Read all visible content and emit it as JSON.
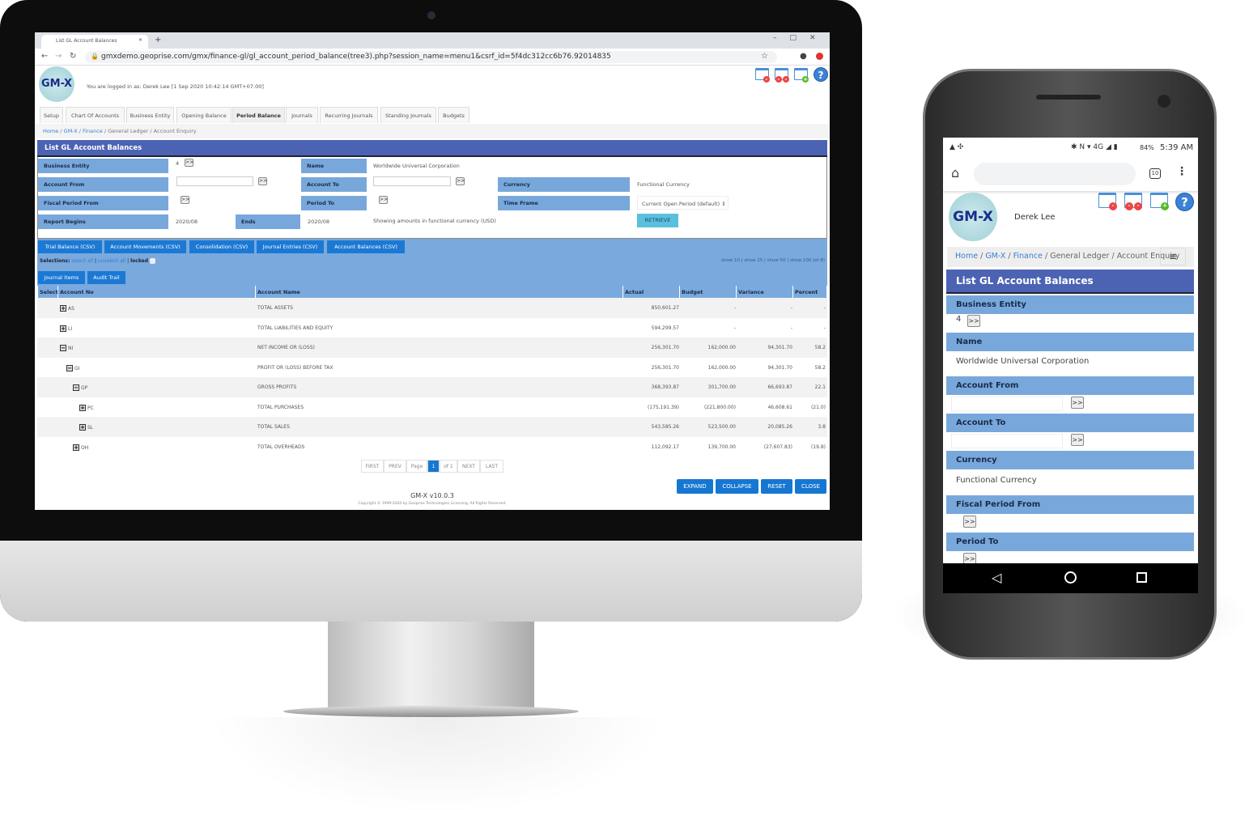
{
  "browser": {
    "tab_title": "List GL Account Balances",
    "url": "gmxdemo.geoprise.com/gmx/finance-gl/gl_account_period_balance(tree3).php?session_name=menu1&csrf_id=5f4dc312cc6b76.92014835"
  },
  "header": {
    "logo": "GM-X",
    "logged_in": "You are logged in as: Derek Lee [1 Sep 2020 10:42:14 GMT+07:00]",
    "icons": [
      "close-window-icon",
      "close-all-windows-icon",
      "new-window-icon",
      "help-icon"
    ],
    "help": "?"
  },
  "nav_tabs": [
    {
      "label": "Setup"
    },
    {
      "label": "Chart Of Accounts"
    },
    {
      "label": "Business Entity"
    },
    {
      "label": "Opening Balance"
    },
    {
      "label": "Period Balance",
      "active": true
    },
    {
      "label": "Journals"
    },
    {
      "label": "Recurring Journals"
    },
    {
      "label": "Standing Journals"
    },
    {
      "label": "Budgets"
    }
  ],
  "breadcrumb": {
    "items": [
      "Home",
      "GM-X",
      "Finance",
      "General Ledger",
      "Account Enquiry"
    ],
    "sep": "/"
  },
  "page_title": "List GL Account Balances",
  "form": {
    "business_entity": {
      "label": "Business Entity",
      "value": "4"
    },
    "name": {
      "label": "Name",
      "value": "Worldwide Universal Corporation"
    },
    "account_from": {
      "label": "Account From",
      "value": ""
    },
    "account_to": {
      "label": "Account To",
      "value": ""
    },
    "currency": {
      "label": "Currency",
      "value": "Functional Currency"
    },
    "fiscal_period_from": {
      "label": "Fiscal Period From"
    },
    "period_to": {
      "label": "Period To"
    },
    "time_frame": {
      "label": "Time Frame",
      "value": "Current Open Period (default) ⇕"
    },
    "report_begins": {
      "label": "Report Begins",
      "value": "2020/08"
    },
    "ends": {
      "label": "Ends",
      "value": "2020/08"
    },
    "note": "Showing amounts in functional currency (USD)",
    "lookup": ">>",
    "retrieve": "RETRIEVE"
  },
  "csv_buttons": [
    "Trial Balance (CSV)",
    "Account Movements (CSV)",
    "Consolidation (CSV)",
    "Journal Entries (CSV)",
    "Account Balances (CSV)"
  ],
  "selections": {
    "label": "Selections:",
    "select_all": "select all",
    "unselect_all": "unselect all",
    "locked": "locked",
    "show": "show 10 | show 25 | show 50 | show 100 (of 8)"
  },
  "sub_buttons": [
    "Journal Items",
    "Audit Trail"
  ],
  "table": {
    "columns": [
      "Select",
      "Account No",
      "Account Name",
      "Actual",
      "Budget",
      "Variance",
      "Percent"
    ],
    "rows": [
      {
        "level": 0,
        "toggle": "+",
        "no": "AS",
        "name": "TOTAL ASSETS",
        "actual": "850,601.27",
        "budget": "-",
        "variance": "-",
        "percent": "-"
      },
      {
        "level": 0,
        "toggle": "+",
        "no": "LI",
        "name": "TOTAL LIABILITIES AND EQUITY",
        "actual": "594,299.57",
        "budget": "-",
        "variance": "-",
        "percent": "-"
      },
      {
        "level": 0,
        "toggle": "−",
        "no": "NI",
        "name": "NET INCOME OR (LOSS)",
        "actual": "256,301.70",
        "budget": "162,000.00",
        "variance": "94,301.70",
        "percent": "58.2"
      },
      {
        "level": 1,
        "toggle": "−",
        "no": "GI",
        "name": "PROFIT OR (LOSS) BEFORE TAX",
        "actual": "256,301.70",
        "budget": "162,000.00",
        "variance": "94,301.70",
        "percent": "58.2"
      },
      {
        "level": 2,
        "toggle": "−",
        "no": "GP",
        "name": "GROSS PROFITS",
        "actual": "368,393.87",
        "budget": "301,700.00",
        "variance": "66,693.87",
        "percent": "22.1"
      },
      {
        "level": 3,
        "toggle": "+",
        "no": "PC",
        "name": "TOTAL PURCHASES",
        "actual": "(175,191.39)",
        "budget": "(221,800.00)",
        "variance": "46,608.61",
        "percent": "(21.0)"
      },
      {
        "level": 3,
        "toggle": "+",
        "no": "SL",
        "name": "TOTAL SALES",
        "actual": "543,585.26",
        "budget": "523,500.00",
        "variance": "20,085.26",
        "percent": "3.8"
      },
      {
        "level": 2,
        "toggle": "+",
        "no": "OH",
        "name": "TOTAL OVERHEADS",
        "actual": "112,092.17",
        "budget": "139,700.00",
        "variance": "(27,607.83)",
        "percent": "(19.8)"
      }
    ]
  },
  "pagination": {
    "first": "FIRST",
    "prev": "PREV",
    "page": "Page",
    "current": "1",
    "of": "of 1",
    "next": "NEXT",
    "last": "LAST"
  },
  "actions": [
    "EXPAND",
    "COLLAPSE",
    "RESET",
    "CLOSE"
  ],
  "footer": {
    "version": "GM-X v10.0.3",
    "copyright": "Copyright © 1999-2020 by Geoprise Technologies Licensing, All Rights Reserved."
  },
  "phone": {
    "status": {
      "battery": "84%",
      "time": "5:39 AM",
      "network": "4G",
      "tabs_count": "10"
    },
    "user": "Derek Lee"
  },
  "colors": {
    "title_bar": "#4c63b3",
    "label_bg": "#78a8db",
    "button": "#1677d2",
    "retrieve": "#5bc0de"
  }
}
